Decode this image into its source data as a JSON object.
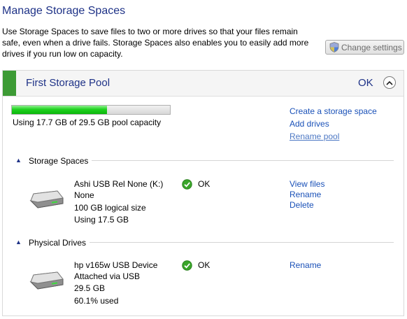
{
  "page": {
    "title": "Manage Storage Spaces",
    "description": "Use Storage Spaces to save files to two or more drives so that your files remain safe, even when a drive fails. Storage Spaces also enables you to easily add more drives if you run low on capacity.",
    "change_settings_label": "Change settings"
  },
  "pool": {
    "name": "First Storage Pool",
    "status": "OK",
    "used_fraction": 0.6,
    "capacity_text": "Using 17.7 GB of 29.5 GB pool capacity",
    "actions": [
      "Create a storage space",
      "Add drives",
      "Rename pool"
    ]
  },
  "storage_spaces": {
    "section_title": "Storage Spaces",
    "items": [
      {
        "name": "Ashi USB Rel None (K:)",
        "resiliency": "None",
        "size": "100 GB logical size",
        "usage": "Using 17.5 GB",
        "status": "OK",
        "actions": [
          "View files",
          "Rename",
          "Delete"
        ]
      }
    ]
  },
  "physical_drives": {
    "section_title": "Physical Drives",
    "items": [
      {
        "name": "hp v165w USB Device",
        "connection": "Attached via USB",
        "size": "29.5 GB",
        "usage": "60.1% used",
        "status": "OK",
        "actions": [
          "Rename"
        ]
      }
    ]
  },
  "icons": {
    "shield": "uac-shield-icon",
    "collapse": "chevron-up-icon",
    "drive": "hard-drive-icon",
    "status_ok": "green-check-icon"
  },
  "colors": {
    "heading": "#1e3287",
    "link": "#1a51b8",
    "pool_strip": "#3d9b35",
    "progress": "#1fd21f"
  }
}
